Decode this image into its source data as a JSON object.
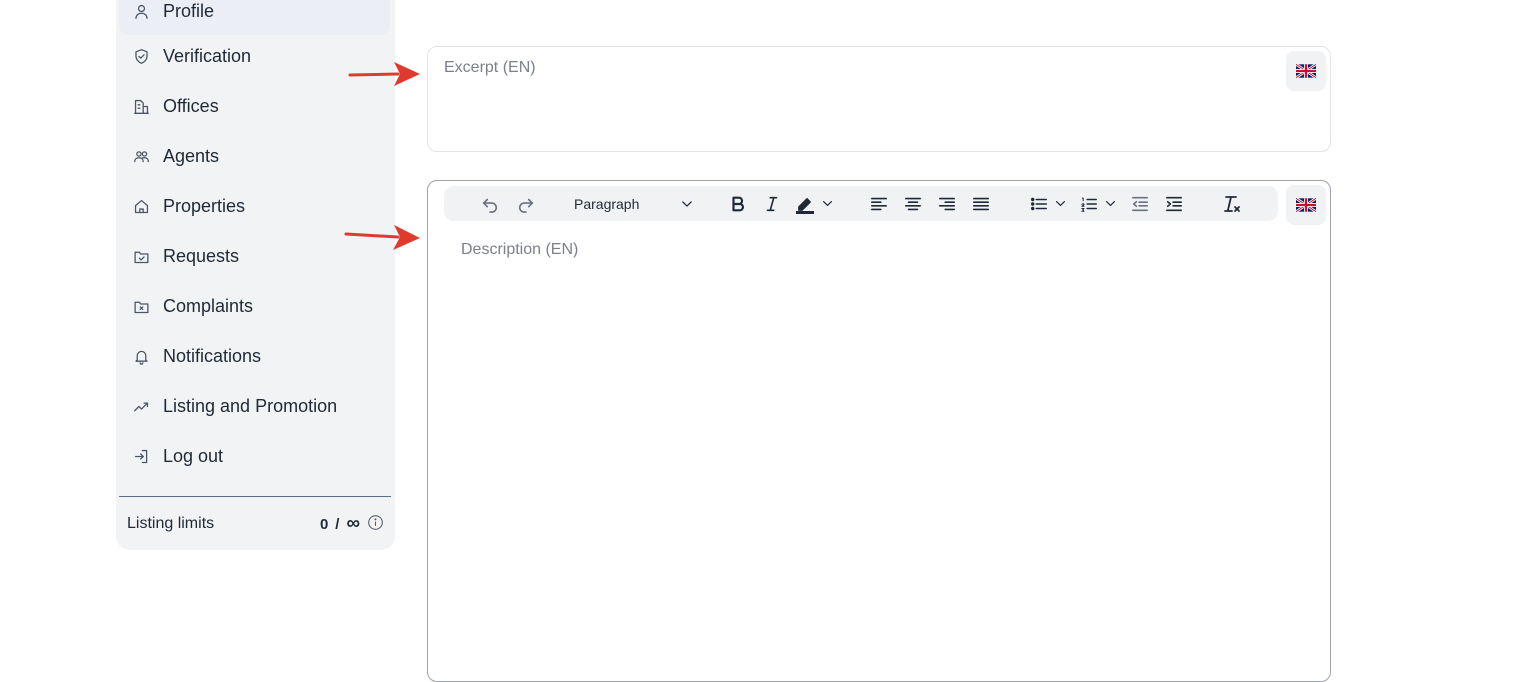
{
  "sidebar": {
    "items": [
      {
        "label": "Profile",
        "icon": "user-icon",
        "active": true
      },
      {
        "label": "Verification",
        "icon": "shield-check-icon"
      },
      {
        "label": "Offices",
        "icon": "office-icon"
      },
      {
        "label": "Agents",
        "icon": "agents-icon"
      },
      {
        "label": "Properties",
        "icon": "home-icon"
      },
      {
        "label": "Requests",
        "icon": "folder-check-icon"
      },
      {
        "label": "Complaints",
        "icon": "folder-x-icon"
      },
      {
        "label": "Notifications",
        "icon": "bell-icon"
      },
      {
        "label": "Listing and Promotion",
        "icon": "trending-up-icon"
      },
      {
        "label": "Log out",
        "icon": "logout-icon"
      }
    ],
    "limits": {
      "label": "Listing limits",
      "used": "0",
      "separator": "/",
      "max": "∞"
    }
  },
  "excerpt": {
    "placeholder": "Excerpt (EN)",
    "language_icon": "uk-flag-icon"
  },
  "editor": {
    "placeholder": "Description (EN)",
    "toolbar": {
      "paragraph_label": "Paragraph"
    },
    "language_icon": "uk-flag-icon"
  },
  "colors": {
    "sidebar_bg": "#f2f3f5",
    "active_item_bg": "#eceef6",
    "arrow": "#e03a2f"
  }
}
